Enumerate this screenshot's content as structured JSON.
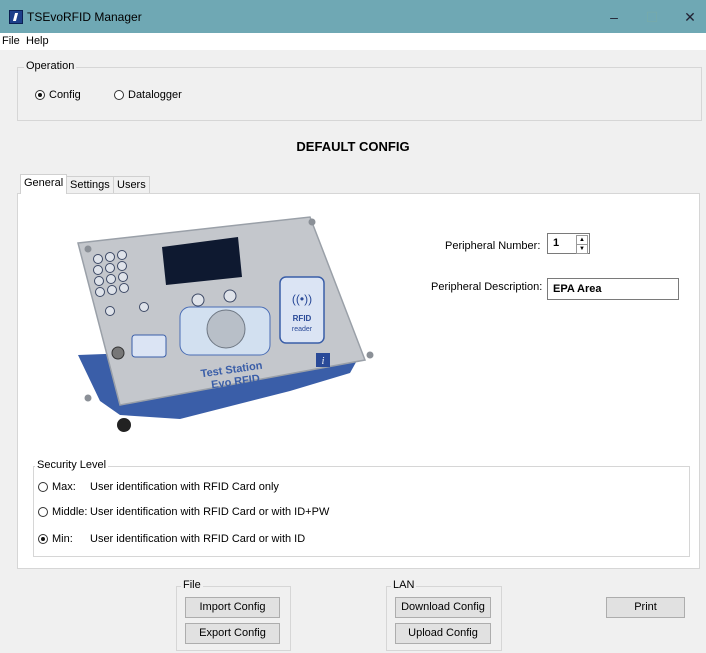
{
  "window": {
    "title": "TSEvoRFID Manager",
    "minimize": "–",
    "maximize": "☐",
    "close": "✕"
  },
  "menu": {
    "file": "File",
    "help": "Help"
  },
  "operation": {
    "label": "Operation",
    "config": "Config",
    "datalogger": "Datalogger",
    "selected": "Config"
  },
  "heading": "DEFAULT CONFIG",
  "tabs": [
    {
      "label": "General"
    },
    {
      "label": "Settings"
    },
    {
      "label": "Users"
    }
  ],
  "device": {
    "label1": "Test Station",
    "label2": "Evo RFID",
    "badge_line1": "RFID",
    "badge_line2": "reader",
    "info": "i"
  },
  "peripheral": {
    "number_label": "Peripheral Number:",
    "number_value": "1",
    "description_label": "Peripheral Description:",
    "description_value": "EPA Area"
  },
  "security": {
    "label": "Security Level",
    "options": [
      {
        "name": "Max:",
        "desc": "User identification with RFID Card only"
      },
      {
        "name": "Middle:",
        "desc": "User identification with RFID Card or with ID+PW"
      },
      {
        "name": "Min:",
        "desc": "User identification with RFID Card or with ID"
      }
    ],
    "selected": "Min:"
  },
  "file_group": {
    "label": "File",
    "import": "Import Config",
    "export": "Export Config"
  },
  "lan_group": {
    "label": "LAN",
    "download": "Download Config",
    "upload": "Upload Config"
  },
  "print": "Print"
}
